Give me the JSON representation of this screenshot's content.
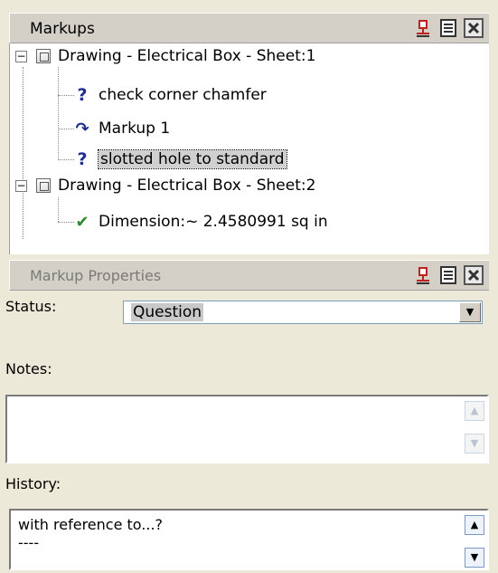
{
  "markups_panel": {
    "title": "Markups",
    "tree": [
      {
        "label": "Drawing - Electrical Box - Sheet:1",
        "expander": "−",
        "icon": "drawing-icon"
      },
      {
        "label": "check corner chamfer",
        "icon": "question-icon",
        "glyph": "?"
      },
      {
        "label": "Markup 1",
        "icon": "curved-arrow-icon",
        "glyph": "↷"
      },
      {
        "label": "slotted hole to standard",
        "icon": "question-icon",
        "glyph": "?",
        "selected": true
      },
      {
        "label": "Drawing - Electrical Box - Sheet:2",
        "expander": "−",
        "icon": "drawing-icon"
      },
      {
        "label": "Dimension:~ 2.4580991 sq in",
        "icon": "checkmark-icon",
        "glyph": "✔"
      }
    ]
  },
  "properties_panel": {
    "title": "Markup Properties",
    "status_label": "Status:",
    "status_value": "Question",
    "notes_label": "Notes:",
    "notes_value": "",
    "history_label": "History:",
    "history_text": "with reference to...?\n----"
  },
  "colors": {
    "panel_bg": "#ece9d8",
    "header_bg": "#d4d0c8",
    "question": "#1e2f8f",
    "check": "#2d8a2d"
  }
}
